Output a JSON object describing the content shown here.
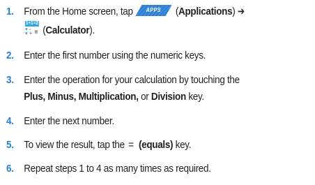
{
  "steps": [
    {
      "num": "1.",
      "line1_a": "From the Home screen, tap",
      "apps_icon_label": "APPS",
      "line1_b": "(",
      "line1_bold": "Applications",
      "line1_c": ") ➔",
      "calc_icon_display": "1+1=2",
      "calc_icon_keys": [
        "+",
        "-",
        "×",
        "÷",
        "="
      ],
      "line2_a": "(",
      "line2_bold": "Calculator",
      "line2_b": ")."
    },
    {
      "num": "2.",
      "text": "Enter the first number using the numeric keys."
    },
    {
      "num": "3.",
      "line1": "Enter the operation for your calculation by touching the",
      "bold_ops": "Plus, Minus, Multiplication,",
      "or": " or ",
      "bold_div": "Division",
      "tail": " key."
    },
    {
      "num": "4.",
      "text": "Enter the next number."
    },
    {
      "num": "5.",
      "a": "To view the result, tap the",
      "eq": "=",
      "bold": "(equals)",
      "b": " key."
    },
    {
      "num": "6.",
      "text": "Repeat steps 1 to 4 as many times as required."
    }
  ],
  "colors": {
    "number": "#2a7fd4",
    "text": "#231f20",
    "apps_button": "#2a7fd4",
    "calc_display": "#2fa7e8"
  },
  "icons": {
    "apps": "apps-button-icon",
    "calculator": "calculator-app-icon"
  }
}
